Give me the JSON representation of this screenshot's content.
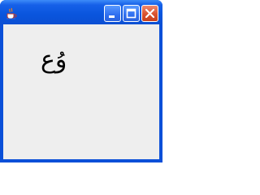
{
  "window": {
    "controls": {
      "minimize_icon": "minimize-icon",
      "maximize_icon": "maximize-icon",
      "close_icon": "close-icon"
    },
    "app_icon": "java-cup-icon"
  },
  "content": {
    "text": "وُع"
  },
  "colors": {
    "titlebar": "#0b52d8",
    "client_background": "#eeeeee",
    "close_button": "#d9532f"
  }
}
